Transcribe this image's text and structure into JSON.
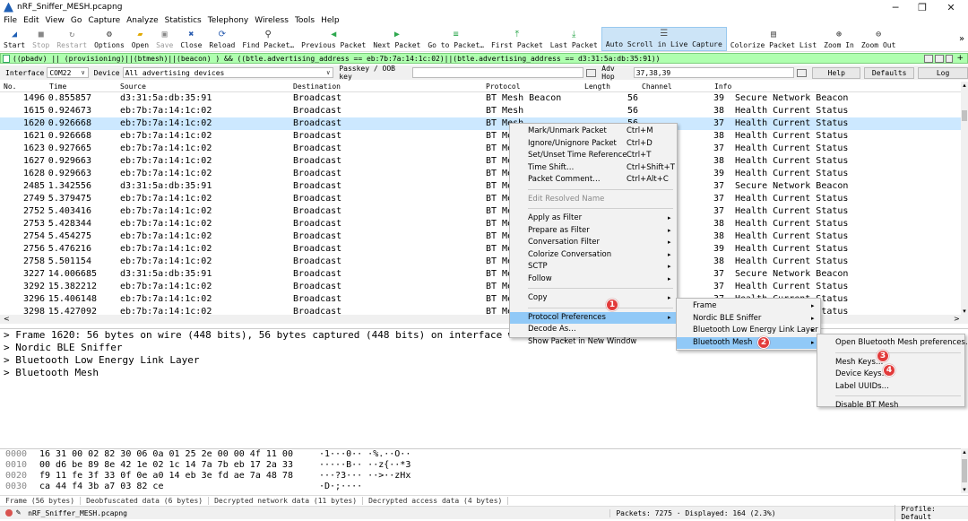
{
  "window": {
    "title": "nRF_Sniffer_MESH.pcapng",
    "min": "─",
    "restore": "❐",
    "close": "✕"
  },
  "menu": [
    "File",
    "Edit",
    "View",
    "Go",
    "Capture",
    "Analyze",
    "Statistics",
    "Telephony",
    "Wireless",
    "Tools",
    "Help"
  ],
  "toolbar": [
    {
      "label": "Start",
      "icon": "shark-fin-icon",
      "glyph": "◢",
      "color": "#1f5fb5",
      "state": "normal"
    },
    {
      "label": "Stop",
      "icon": "stop-icon",
      "glyph": "■",
      "color": "#888888",
      "state": "disabled"
    },
    {
      "label": "Restart",
      "icon": "restart-icon",
      "glyph": "↻",
      "color": "#888888",
      "state": "disabled"
    },
    {
      "label": "Options",
      "icon": "gear-icon",
      "glyph": "⚙",
      "color": "#333333",
      "state": "normal"
    },
    {
      "label": "Open",
      "icon": "folder-icon",
      "glyph": "▰",
      "color": "#e0a800",
      "state": "normal"
    },
    {
      "label": "Save",
      "icon": "save-icon",
      "glyph": "▣",
      "color": "#888888",
      "state": "disabled"
    },
    {
      "label": "Close",
      "icon": "close-file-icon",
      "glyph": "✖",
      "color": "#2a5db0",
      "state": "normal"
    },
    {
      "label": "Reload",
      "icon": "reload-icon",
      "glyph": "⟳",
      "color": "#2a5db0",
      "state": "normal"
    },
    {
      "label": "Find Packet…",
      "icon": "magnifier-icon",
      "glyph": "⚲",
      "color": "#333333",
      "state": "normal"
    },
    {
      "label": "Previous Packet",
      "icon": "arrow-left-icon",
      "glyph": "◀",
      "color": "#2fa84f",
      "state": "normal"
    },
    {
      "label": "Next Packet",
      "icon": "arrow-right-icon",
      "glyph": "▶",
      "color": "#2fa84f",
      "state": "normal"
    },
    {
      "label": "Go to Packet…",
      "icon": "goto-icon",
      "glyph": "≡",
      "color": "#2fa84f",
      "state": "normal"
    },
    {
      "label": "First Packet",
      "icon": "first-packet-icon",
      "glyph": "⤒",
      "color": "#2fa84f",
      "state": "normal"
    },
    {
      "label": "Last Packet",
      "icon": "last-packet-icon",
      "glyph": "⤓",
      "color": "#2fa84f",
      "state": "normal"
    },
    {
      "label": "Auto Scroll in Live Capture",
      "icon": "autoscroll-icon",
      "glyph": "☰",
      "color": "#555555",
      "state": "active"
    },
    {
      "label": "Colorize Packet List",
      "icon": "colorize-icon",
      "glyph": "▤",
      "color": "#555555",
      "state": "normal"
    },
    {
      "label": "Zoom In",
      "icon": "zoom-in-icon",
      "glyph": "⊕",
      "color": "#333333",
      "state": "normal"
    },
    {
      "label": "Zoom Out",
      "icon": "zoom-out-icon",
      "glyph": "⊖",
      "color": "#333333",
      "state": "normal"
    }
  ],
  "toolbar_overflow": "»",
  "filter": {
    "text": "((pbadv) || (provisioning)||(btmesh)||(beacon) ) && ((btle.advertising_address == eb:7b:7a:14:1c:02)||(btle.advertising_address == d3:31:5a:db:35:91))",
    "plus": "+"
  },
  "interface_bar": {
    "interface_label": "Interface",
    "interface_value": "COM22",
    "device_label": "Device",
    "device_value": "All advertising devices",
    "passkey_label": "Passkey / OOB key",
    "passkey_value": "",
    "adv_hop_label": "Adv Hop",
    "adv_hop_value": "37,38,39",
    "help": "Help",
    "defaults": "Defaults",
    "log": "Log"
  },
  "columns": [
    "No.",
    "Time",
    "Source",
    "Destination",
    "Protocol",
    "Length",
    "Channel",
    "Info"
  ],
  "packets": [
    [
      "1496",
      "0.855857",
      "d3:31:5a:db:35:91",
      "Broadcast",
      "BT Mesh Beacon",
      "56",
      "39",
      "Secure Network Beacon"
    ],
    [
      "1615",
      "0.924673",
      "eb:7b:7a:14:1c:02",
      "Broadcast",
      "BT Mesh",
      "56",
      "38",
      "Health Current Status"
    ],
    [
      "1620",
      "0.926668",
      "eb:7b:7a:14:1c:02",
      "Broadcast",
      "BT Mesh",
      "56",
      "37",
      "Health Current Status"
    ],
    [
      "1621",
      "0.926668",
      "eb:7b:7a:14:1c:02",
      "Broadcast",
      "BT Mesh",
      "56",
      "38",
      "Health Current Status"
    ],
    [
      "1623",
      "0.927665",
      "eb:7b:7a:14:1c:02",
      "Broadcast",
      "BT Mesh",
      "56",
      "37",
      "Health Current Status"
    ],
    [
      "1627",
      "0.929663",
      "eb:7b:7a:14:1c:02",
      "Broadcast",
      "BT Mesh",
      "56",
      "38",
      "Health Current Status"
    ],
    [
      "1628",
      "0.929663",
      "eb:7b:7a:14:1c:02",
      "Broadcast",
      "BT Mesh",
      "56",
      "39",
      "Health Current Status"
    ],
    [
      "2485",
      "1.342556",
      "d3:31:5a:db:35:91",
      "Broadcast",
      "BT Mesh Beacon",
      "56",
      "37",
      "Secure Network Beacon"
    ],
    [
      "2749",
      "5.379475",
      "eb:7b:7a:14:1c:02",
      "Broadcast",
      "BT Mesh",
      "56",
      "37",
      "Health Current Status"
    ],
    [
      "2752",
      "5.403416",
      "eb:7b:7a:14:1c:02",
      "Broadcast",
      "BT Mesh",
      "56",
      "37",
      "Health Current Status"
    ],
    [
      "2753",
      "5.428344",
      "eb:7b:7a:14:1c:02",
      "Broadcast",
      "BT Mesh",
      "56",
      "38",
      "Health Current Status"
    ],
    [
      "2754",
      "5.454275",
      "eb:7b:7a:14:1c:02",
      "Broadcast",
      "BT Mesh",
      "56",
      "38",
      "Health Current Status"
    ],
    [
      "2756",
      "5.476216",
      "eb:7b:7a:14:1c:02",
      "Broadcast",
      "BT Mesh",
      "56",
      "39",
      "Health Current Status"
    ],
    [
      "2758",
      "5.501154",
      "eb:7b:7a:14:1c:02",
      "Broadcast",
      "BT Mesh",
      "56",
      "38",
      "Health Current Status"
    ],
    [
      "3227",
      "14.006685",
      "d3:31:5a:db:35:91",
      "Broadcast",
      "BT Mesh",
      "56",
      "37",
      "Secure Network Beacon"
    ],
    [
      "3292",
      "15.382212",
      "eb:7b:7a:14:1c:02",
      "Broadcast",
      "BT Mesh",
      "56",
      "37",
      "Health Current Status"
    ],
    [
      "3296",
      "15.406148",
      "eb:7b:7a:14:1c:02",
      "Broadcast",
      "BT Mesh",
      "56",
      "37",
      "Health Current Status"
    ],
    [
      "3298",
      "15.427092",
      "eb:7b:7a:14:1c:02",
      "Broadcast",
      "BT Mesh",
      "56",
      "37",
      "Health Current Status"
    ]
  ],
  "selected_row": 2,
  "details": [
    "> Frame 1620: 56 bytes on wire (448 bits), 56 bytes captured (448 bits) on interface wireshark_extcap2032, id 0",
    "> Nordic BLE Sniffer",
    "> Bluetooth Low Energy Link Layer",
    "> Bluetooth Mesh"
  ],
  "hex": [
    {
      "off": "0000",
      "hex": "16 31 00 02 82 30 06 0a  01 25 2e 00 00 4f 11 00",
      "ascii": "·1···0·· ·%.··O··"
    },
    {
      "off": "0010",
      "hex": "00 d6 be 89 8e 42 1e 02  1c 14 7a 7b eb 17 2a 33",
      "ascii": "·····B·· ··z{··*3"
    },
    {
      "off": "0020",
      "hex": "f9 11 fe 3f 33 0f 0e a0  14 eb 3e fd ae 7a 48 78",
      "ascii": "···?3··· ··>··zHx"
    },
    {
      "off": "0030",
      "hex": "ca 44 f4 3b a7 03 82 ce",
      "ascii": "·D·;····"
    }
  ],
  "bytes_tabs": [
    "Frame (56 bytes)",
    "Deobfuscated data (6 bytes)",
    "Decrypted network data (11 bytes)",
    "Decrypted access data (4 bytes)"
  ],
  "status": {
    "file": "nRF_Sniffer_MESH.pcapng",
    "packets": "Packets: 7275 · Displayed: 164 (2.3%)",
    "profile": "Profile: Default"
  },
  "context_menu": {
    "items": [
      {
        "label": "Mark/Unmark Packet",
        "shortcut": "Ctrl+M",
        "sub": false
      },
      {
        "label": "Ignore/Unignore Packet",
        "shortcut": "Ctrl+D",
        "sub": false
      },
      {
        "label": "Set/Unset Time Reference",
        "shortcut": "Ctrl+T",
        "sub": false
      },
      {
        "label": "Time Shift…",
        "shortcut": "Ctrl+Shift+T",
        "sub": false
      },
      {
        "label": "Packet Comment…",
        "shortcut": "Ctrl+Alt+C",
        "sub": false
      },
      {
        "sep": true
      },
      {
        "label": "Edit Resolved Name",
        "shortcut": "",
        "sub": false,
        "disabled": true
      },
      {
        "sep": true
      },
      {
        "label": "Apply as Filter",
        "shortcut": "",
        "sub": true
      },
      {
        "label": "Prepare as Filter",
        "shortcut": "",
        "sub": true
      },
      {
        "label": "Conversation Filter",
        "shortcut": "",
        "sub": true
      },
      {
        "label": "Colorize Conversation",
        "shortcut": "",
        "sub": true
      },
      {
        "label": "SCTP",
        "shortcut": "",
        "sub": true
      },
      {
        "label": "Follow",
        "shortcut": "",
        "sub": true
      },
      {
        "sep": true
      },
      {
        "label": "Copy",
        "shortcut": "",
        "sub": true
      },
      {
        "sep": true
      },
      {
        "label": "Protocol Preferences",
        "shortcut": "",
        "sub": true,
        "highlight": true
      },
      {
        "label": "Decode As…",
        "shortcut": "",
        "sub": false
      },
      {
        "label": "Show Packet in New Window",
        "shortcut": "",
        "sub": false
      }
    ]
  },
  "submenu_protocols": [
    {
      "label": "Frame",
      "sub": true
    },
    {
      "label": "Nordic BLE Sniffer",
      "sub": true
    },
    {
      "label": "Bluetooth Low Energy Link Layer",
      "sub": true
    },
    {
      "label": "Bluetooth Mesh",
      "sub": true,
      "highlight": true
    }
  ],
  "submenu_mesh": [
    {
      "label": "Open Bluetooth Mesh preferences…"
    },
    {
      "sep": true
    },
    {
      "label": "Mesh Keys…"
    },
    {
      "label": "Device Keys…"
    },
    {
      "label": "Label UUIDs…"
    },
    {
      "sep": true
    },
    {
      "label": "Disable BT Mesh"
    }
  ],
  "badges": [
    "1",
    "2",
    "3",
    "4"
  ],
  "arrow": "▸",
  "scroll": {
    "up": "▴",
    "down": "▾",
    "left": "<",
    "right": ">"
  }
}
